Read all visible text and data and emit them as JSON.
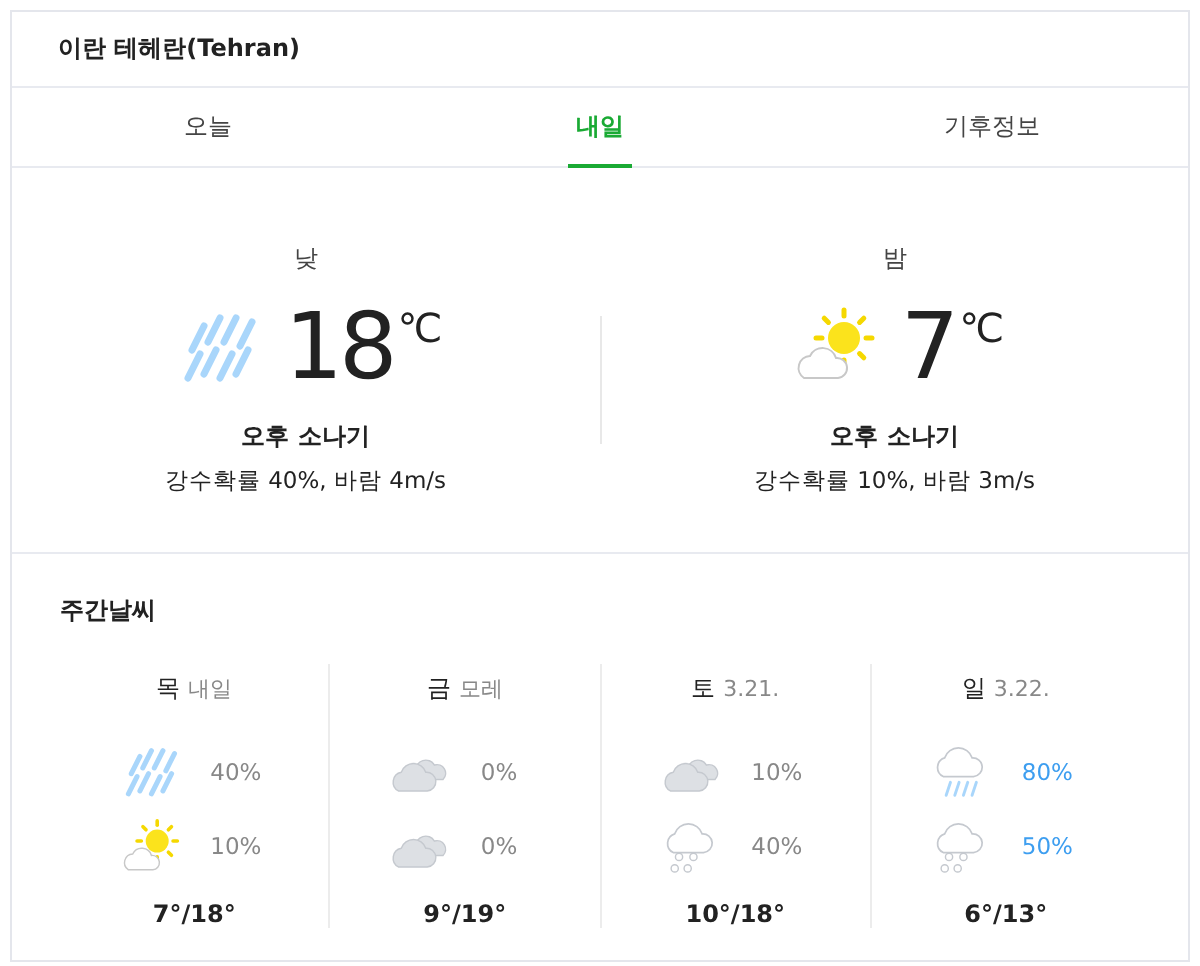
{
  "location": "이란 테헤란(Tehran)",
  "tabs": [
    {
      "label": "오늘",
      "selected": false
    },
    {
      "label": "내일",
      "selected": true
    },
    {
      "label": "기후정보",
      "selected": false
    }
  ],
  "current": [
    {
      "period": "낮",
      "kind": "rain",
      "temp": "18",
      "unit": "℃",
      "summary": "오후 소나기",
      "detail": "강수확률 40%, 바람 4m/s"
    },
    {
      "period": "밤",
      "kind": "sun-cloud",
      "temp": "7",
      "unit": "℃",
      "summary": "오후 소나기",
      "detail": "강수확률 10%, 바람 3m/s"
    }
  ],
  "weekly": {
    "title": "주간날씨",
    "days": [
      {
        "day": "목",
        "date": "내일",
        "slots": [
          {
            "kind": "rain",
            "chance": "40%",
            "high": false
          },
          {
            "kind": "sun-cloud",
            "chance": "10%",
            "high": false
          }
        ],
        "range": "7°/18°"
      },
      {
        "day": "금",
        "date": "모레",
        "slots": [
          {
            "kind": "cloudy",
            "chance": "0%",
            "high": false
          },
          {
            "kind": "cloudy",
            "chance": "0%",
            "high": false
          }
        ],
        "range": "9°/19°"
      },
      {
        "day": "토",
        "date": "3.21.",
        "slots": [
          {
            "kind": "cloudy",
            "chance": "10%",
            "high": false
          },
          {
            "kind": "snow-cloud",
            "chance": "40%",
            "high": false
          }
        ],
        "range": "10°/18°"
      },
      {
        "day": "일",
        "date": "3.22.",
        "slots": [
          {
            "kind": "rain-cloud",
            "chance": "80%",
            "high": true
          },
          {
            "kind": "snow-cloud",
            "chance": "50%",
            "high": true
          }
        ],
        "range": "6°/13°"
      }
    ]
  }
}
